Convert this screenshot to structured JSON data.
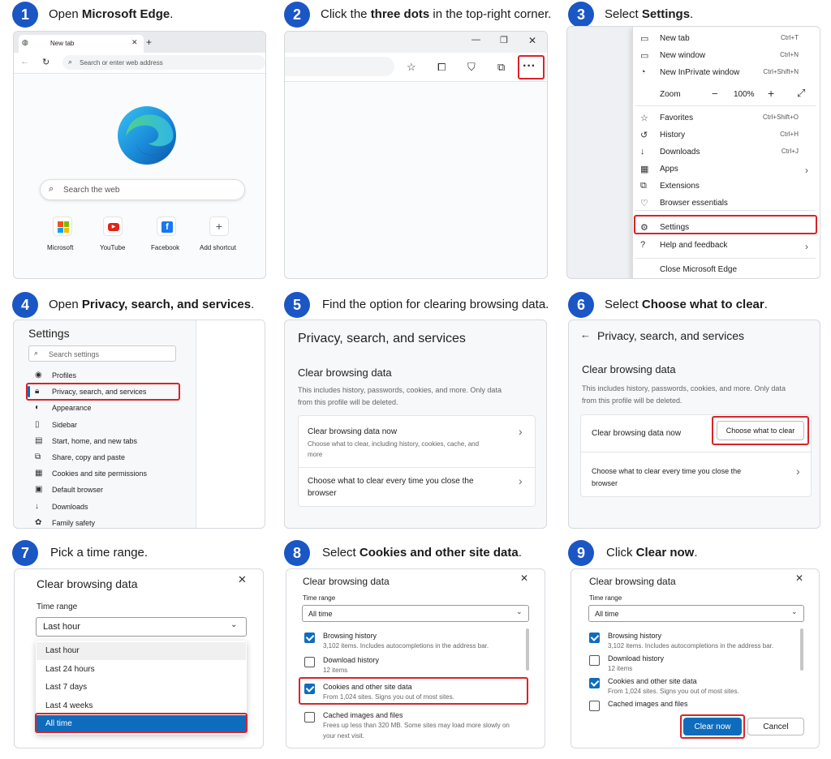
{
  "steps": [
    {
      "num": "1",
      "pre": "Open ",
      "bold": "Microsoft Edge",
      "post": "."
    },
    {
      "num": "2",
      "pre": "Click the ",
      "bold": "three dots",
      "post": " in the top-right corner."
    },
    {
      "num": "3",
      "pre": "Select ",
      "bold": "Settings",
      "post": "."
    },
    {
      "num": "4",
      "pre": "Open ",
      "bold": "Privacy, search, and services",
      "post": "."
    },
    {
      "num": "5",
      "pre": "Find the option for clearing browsing data.",
      "bold": "",
      "post": ""
    },
    {
      "num": "6",
      "pre": "Select ",
      "bold": "Choose what to clear",
      "post": "."
    },
    {
      "num": "7",
      "pre": "Pick a time range.",
      "bold": "",
      "post": ""
    },
    {
      "num": "8",
      "pre": "Select ",
      "bold": "Cookies and other site data",
      "post": "."
    },
    {
      "num": "9",
      "pre": "Click ",
      "bold": "Clear now",
      "post": "."
    }
  ],
  "p1": {
    "tab": "New tab",
    "address_placeholder": "Search or enter web address",
    "search_placeholder": "Search the web",
    "shortcuts": [
      "Microsoft",
      "YouTube",
      "Facebook",
      "Add shortcut"
    ]
  },
  "p2": {
    "more": "···"
  },
  "p3": {
    "menu": [
      {
        "icon": "▭",
        "label": "New tab",
        "shortcut": "Ctrl+T"
      },
      {
        "icon": "▭",
        "label": "New window",
        "shortcut": "Ctrl+N"
      },
      {
        "icon": "◔",
        "label": "New InPrivate window",
        "shortcut": "Ctrl+Shift+N"
      },
      {
        "icon": "",
        "label": "Zoom",
        "shortcut": ""
      },
      {
        "icon": "☆",
        "label": "Favorites",
        "shortcut": "Ctrl+Shift+O"
      },
      {
        "icon": "↺",
        "label": "History",
        "shortcut": "Ctrl+H"
      },
      {
        "icon": "↓",
        "label": "Downloads",
        "shortcut": "Ctrl+J"
      },
      {
        "icon": "▦",
        "label": "Apps",
        "shortcut": "›"
      },
      {
        "icon": "⧉",
        "label": "Extensions",
        "shortcut": ""
      },
      {
        "icon": "♡",
        "label": "Browser essentials",
        "shortcut": ""
      },
      {
        "icon": "⚙",
        "label": "Settings",
        "shortcut": ""
      },
      {
        "icon": "?",
        "label": "Help and feedback",
        "shortcut": "›"
      },
      {
        "icon": "",
        "label": "Close Microsoft Edge",
        "shortcut": ""
      }
    ],
    "zoom_minus": "−",
    "zoom_value": "100%",
    "zoom_plus": "+",
    "fullscreen": "⤢"
  },
  "p4": {
    "title": "Settings",
    "search_placeholder": "Search settings",
    "items": [
      {
        "icon": "◉",
        "label": "Profiles"
      },
      {
        "icon": "🔒︎",
        "label": "Privacy, search, and services"
      },
      {
        "icon": "◐",
        "label": "Appearance"
      },
      {
        "icon": "▯",
        "label": "Sidebar"
      },
      {
        "icon": "▤",
        "label": "Start, home, and new tabs"
      },
      {
        "icon": "⧉",
        "label": "Share, copy and paste"
      },
      {
        "icon": "▦",
        "label": "Cookies and site permissions"
      },
      {
        "icon": "▣",
        "label": "Default browser"
      },
      {
        "icon": "↓",
        "label": "Downloads"
      },
      {
        "icon": "✿",
        "label": "Family safety"
      }
    ]
  },
  "p5": {
    "heading": "Privacy, search, and services",
    "section": "Clear browsing data",
    "desc1": "This includes history, passwords, cookies, and more. Only data",
    "desc2": "from this profile will be deleted.",
    "row1_title": "Clear browsing data now",
    "row1_sub1": "Choose what to clear, including history, cookies, cache, and",
    "row1_sub2": "more",
    "row2_title1": "Choose what to clear every time you close the",
    "row2_title2": "browser"
  },
  "p6": {
    "heading": "Privacy, search, and services",
    "section": "Clear browsing data",
    "desc1": "This includes history, passwords, cookies, and more. Only data",
    "desc2": "from this profile will be deleted.",
    "row1_title": "Clear browsing data now",
    "button": "Choose what to clear",
    "row2_title1": "Choose what to clear every time you close the",
    "row2_title2": "browser"
  },
  "p7": {
    "title": "Clear browsing data",
    "time_label": "Time range",
    "selected": "Last hour",
    "options": [
      "Last hour",
      "Last 24 hours",
      "Last 7 days",
      "Last 4 weeks",
      "All time"
    ]
  },
  "p8": {
    "title": "Clear browsing data",
    "time_label": "Time range",
    "selected": "All time",
    "items": [
      {
        "label": "Browsing history",
        "sub": "3,102 items. Includes autocompletions in the address bar.",
        "checked": true
      },
      {
        "label": "Download history",
        "sub": "12 items",
        "checked": false
      },
      {
        "label": "Cookies and other site data",
        "sub": "From 1,024 sites. Signs you out of most sites.",
        "checked": true
      },
      {
        "label": "Cached images and files",
        "sub": "Frees up less than 320 MB. Some sites may load more slowly on",
        "checked": false
      }
    ],
    "cached_sub2": "your next visit."
  },
  "p9": {
    "title": "Clear browsing data",
    "time_label": "Time range",
    "selected": "All time",
    "items": [
      {
        "label": "Browsing history",
        "sub": "3,102 items. Includes autocompletions in the address bar.",
        "checked": true
      },
      {
        "label": "Download history",
        "sub": "12 items",
        "checked": false
      },
      {
        "label": "Cookies and other site data",
        "sub": "From 1,024 sites. Signs you out of most sites.",
        "checked": true
      },
      {
        "label": "Cached images and files",
        "sub": "",
        "checked": false
      }
    ],
    "clear": "Clear now",
    "cancel": "Cancel"
  },
  "colors": {
    "accent": "#1a56c4",
    "highlight": "#d9232a",
    "primary_button": "#0f6cbd"
  }
}
